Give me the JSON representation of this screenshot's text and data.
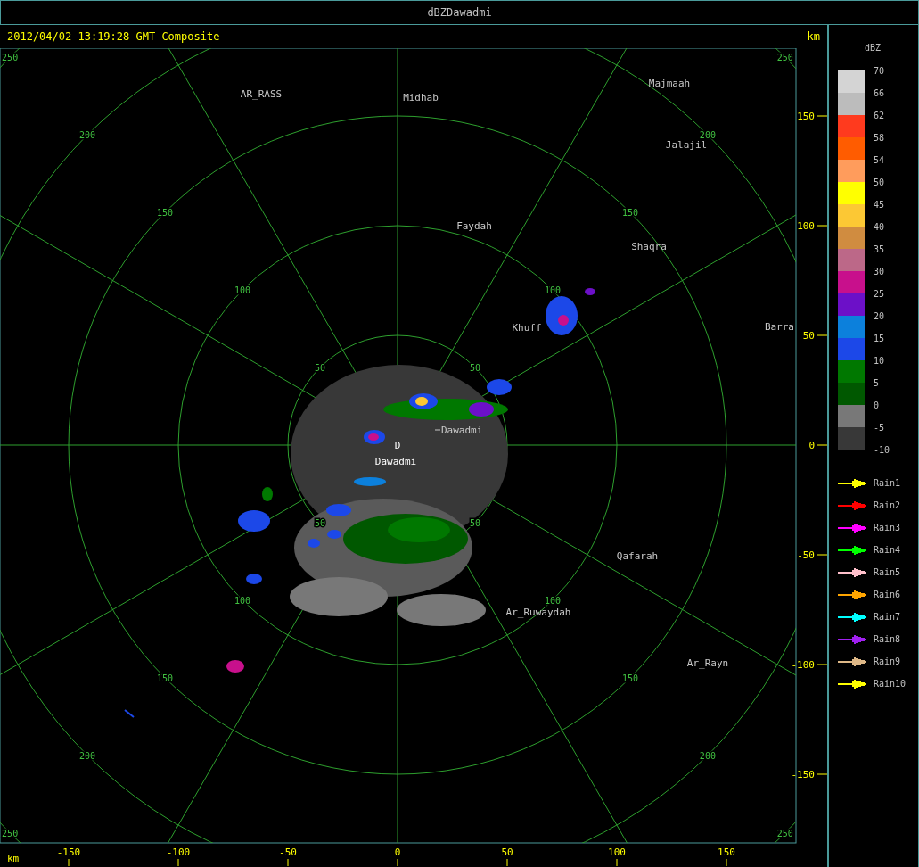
{
  "window": {
    "title": "dBZDawadmi"
  },
  "header": {
    "timestamp": "2012/04/02 13:19:28 GMT Composite",
    "unit": "km"
  },
  "map": {
    "places": [
      {
        "name": "AR_RASS"
      },
      {
        "name": "Midhab"
      },
      {
        "name": "Majmaah"
      },
      {
        "name": "Jalajil"
      },
      {
        "name": "Faydah"
      },
      {
        "name": "Shaqra"
      },
      {
        "name": "Khuff"
      },
      {
        "name": "Barra"
      },
      {
        "name": "Dawadmi"
      },
      {
        "name": "Qafarah"
      },
      {
        "name": "Ar_Ruwaydah"
      },
      {
        "name": "Ar_Rayn"
      }
    ],
    "radar_site": {
      "marker": "D",
      "name": "Dawadmi"
    },
    "range_rings": [
      {
        "labels": [
          "50",
          "50",
          "50",
          "50"
        ]
      },
      {
        "labels": [
          "100",
          "100",
          "100",
          "100"
        ]
      },
      {
        "labels": [
          "150",
          "150",
          "150",
          "150"
        ]
      },
      {
        "labels": [
          "200",
          "200",
          "200",
          "200"
        ]
      },
      {
        "labels": [
          "250",
          "250",
          "250",
          "250"
        ]
      }
    ]
  },
  "y_axis": {
    "ticks": [
      "150",
      "100",
      "50",
      "0",
      "-50",
      "-100",
      "-150"
    ]
  },
  "x_axis": {
    "unit": "km",
    "ticks": [
      "-150",
      "-100",
      "-50",
      "0",
      "50",
      "100",
      "150"
    ]
  },
  "legend": {
    "title": "dBZ",
    "bins": [
      {
        "color": "#d4d4d4"
      },
      {
        "color": "#bcbcbc"
      },
      {
        "color": "#ff3a1e"
      },
      {
        "color": "#ff5c00"
      },
      {
        "color": "#ff9c5c"
      },
      {
        "color": "#ffff00"
      },
      {
        "color": "#fcc834"
      },
      {
        "color": "#d08c40"
      },
      {
        "color": "#bc6888"
      },
      {
        "color": "#c8108c"
      },
      {
        "color": "#6c10c8"
      },
      {
        "color": "#0c80dc"
      },
      {
        "color": "#1c48e8"
      },
      {
        "color": "#007800"
      },
      {
        "color": "#005800"
      },
      {
        "color": "#787878"
      },
      {
        "color": "#383838"
      }
    ],
    "labels": [
      "70",
      "66",
      "62",
      "58",
      "54",
      "50",
      "45",
      "40",
      "35",
      "30",
      "25",
      "20",
      "15",
      "10",
      "5",
      "0",
      "-5",
      "-10"
    ],
    "storm_tracks": [
      {
        "label": "Rain1",
        "color": "#ffff00"
      },
      {
        "label": "Rain2",
        "color": "#ff0000"
      },
      {
        "label": "Rain3",
        "color": "#ff00ff"
      },
      {
        "label": "Rain4",
        "color": "#00ff00"
      },
      {
        "label": "Rain5",
        "color": "#ffc0cb"
      },
      {
        "label": "Rain6",
        "color": "#ffa500"
      },
      {
        "label": "Rain7",
        "color": "#00ffff"
      },
      {
        "label": "Rain8",
        "color": "#a020f0"
      },
      {
        "label": "Rain9",
        "color": "#deb887"
      },
      {
        "label": "Rain10",
        "color": "#ffff00"
      }
    ]
  }
}
